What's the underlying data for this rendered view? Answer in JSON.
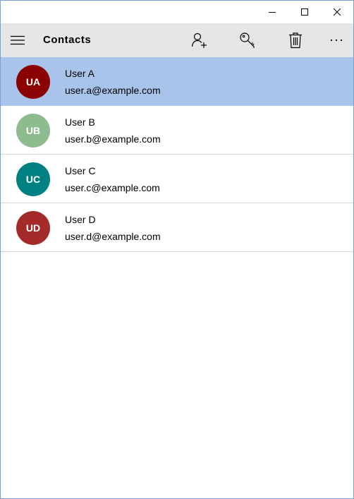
{
  "window": {
    "caption_buttons": [
      {
        "name": "minimize",
        "icon": "minimize-icon"
      },
      {
        "name": "maximize",
        "icon": "maximize-icon"
      },
      {
        "name": "close",
        "icon": "close-icon"
      }
    ]
  },
  "command_bar": {
    "title": "Contacts",
    "menu_icon": "hamburger-menu-icon",
    "actions": [
      {
        "name": "add-contact",
        "icon": "add-person-icon"
      },
      {
        "name": "keys",
        "icon": "key-icon"
      },
      {
        "name": "delete",
        "icon": "trash-icon"
      },
      {
        "name": "more",
        "icon": "more-ellipsis-icon",
        "label": "···"
      }
    ]
  },
  "contacts": [
    {
      "initials": "UA",
      "name": "User A",
      "email": "user.a@example.com",
      "color": "#8b0000",
      "selected": true
    },
    {
      "initials": "UB",
      "name": "User B",
      "email": "user.b@example.com",
      "color": "#8fbc8f",
      "selected": false
    },
    {
      "initials": "UC",
      "name": "User C",
      "email": "user.c@example.com",
      "color": "#008080",
      "selected": false
    },
    {
      "initials": "UD",
      "name": "User D",
      "email": "user.d@example.com",
      "color": "#a52a2a",
      "selected": false
    }
  ],
  "colors": {
    "selection": "#a8c4ea",
    "command_bar_bg": "#e6e6e6",
    "window_border": "#7a9fd8"
  }
}
